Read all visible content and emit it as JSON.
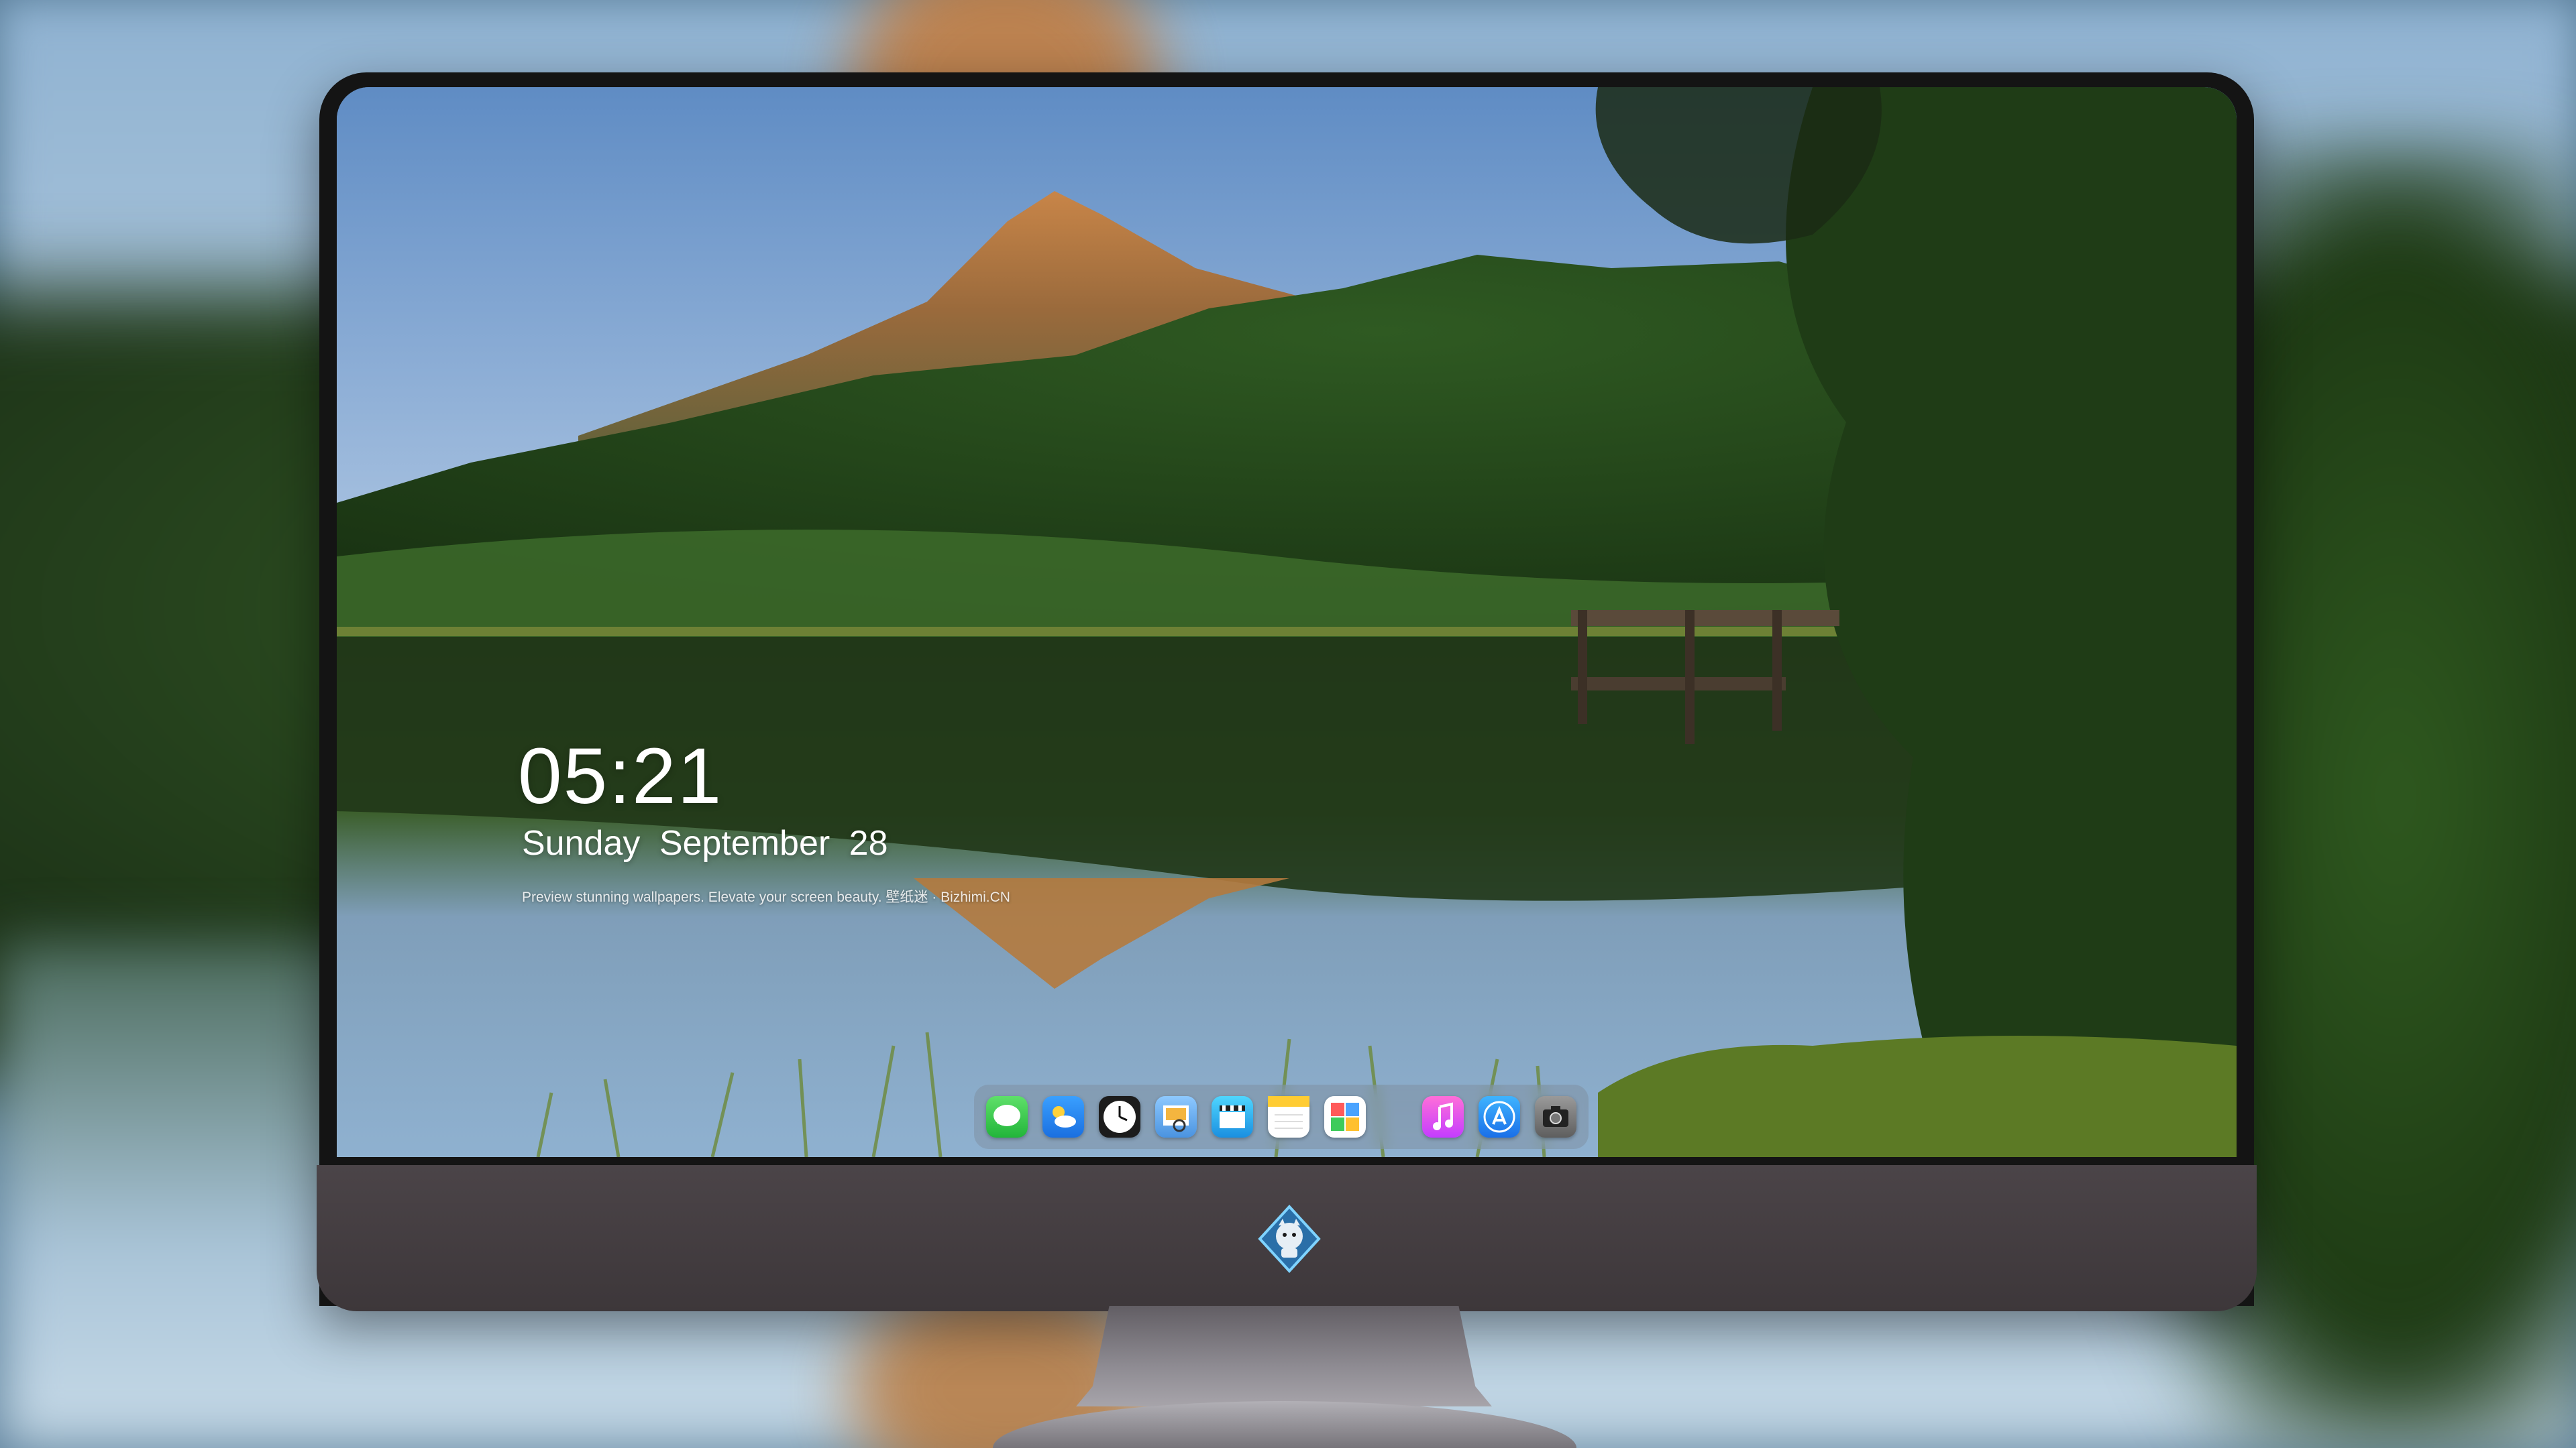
{
  "lockscreen": {
    "time": "05:21",
    "weekday": "Sunday",
    "month": "September",
    "day": "28",
    "tagline": "Preview stunning wallpapers. Elevate your screen beauty. 壁纸迷 · Bizhimi.CN"
  },
  "dock": {
    "apps": [
      {
        "name": "Messages",
        "icon": "messages-icon"
      },
      {
        "name": "Weather",
        "icon": "weather-icon"
      },
      {
        "name": "Clock",
        "icon": "clock-icon"
      },
      {
        "name": "Preview",
        "icon": "preview-icon"
      },
      {
        "name": "Clips",
        "icon": "clapperboard-icon"
      },
      {
        "name": "Notes",
        "icon": "notes-icon"
      },
      {
        "name": "Photo Booth",
        "icon": "photo-grid-icon"
      },
      {
        "name": "Music",
        "icon": "music-icon"
      },
      {
        "name": "App Store",
        "icon": "app-store-icon"
      },
      {
        "name": "Camera",
        "icon": "camera-icon"
      }
    ]
  },
  "chin_logo": "mascot-logo",
  "colors": {
    "bezel": "#141414",
    "chin": "#433d40",
    "sky_top": "#6a8fc0",
    "forest": "#2f5a24",
    "peak": "#c07a3e"
  }
}
